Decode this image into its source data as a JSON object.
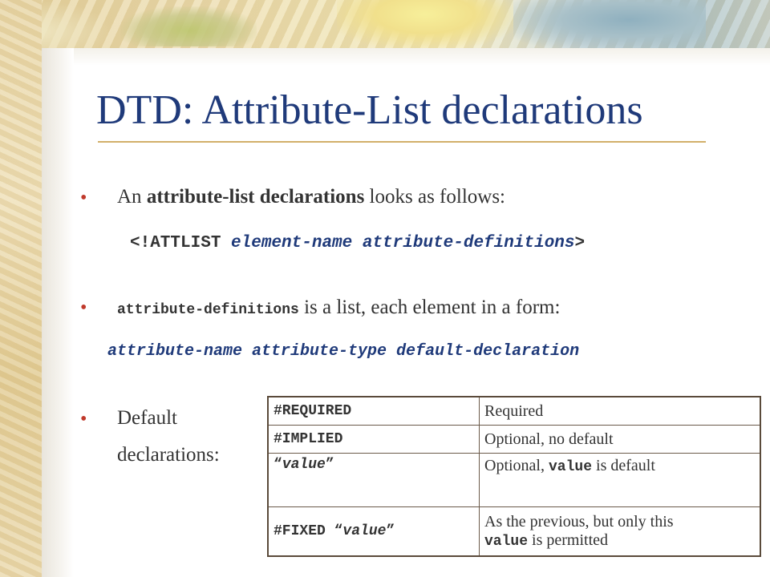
{
  "slide": {
    "title": "DTD: Attribute-List declarations",
    "bullet1": {
      "prefix": "An ",
      "bold": "attribute-list declarations",
      "suffix": " looks as follows:"
    },
    "syntax": {
      "open": "<!ATTLIST ",
      "params": "element-name attribute-definitions",
      "close": ">"
    },
    "bullet2": {
      "code": "attribute-definitions",
      "text": " is a list, each element in a form:"
    },
    "form": "attribute-name attribute-type default-declaration",
    "bullet3": {
      "line1": "Default",
      "line2": "declarations:"
    },
    "table": {
      "rows": [
        {
          "key": "#REQUIRED",
          "desc": "Required"
        },
        {
          "key": "#IMPLIED",
          "desc": "Optional, no default"
        },
        {
          "key_open": "“",
          "key_value": "value",
          "key_close": "”",
          "desc_prefix": "Optional, ",
          "desc_code": "value",
          "desc_suffix": " is default"
        },
        {
          "key_prefix": "#FIXED “",
          "key_value": "value",
          "key_close": "”",
          "desc_line1": "As the previous, but only this",
          "desc_code": "value",
          "desc_suffix": " is permitted"
        }
      ]
    },
    "colors": {
      "title": "#1f3a7a",
      "bullet": "#c0392b",
      "rule": "#d2b06a"
    }
  }
}
